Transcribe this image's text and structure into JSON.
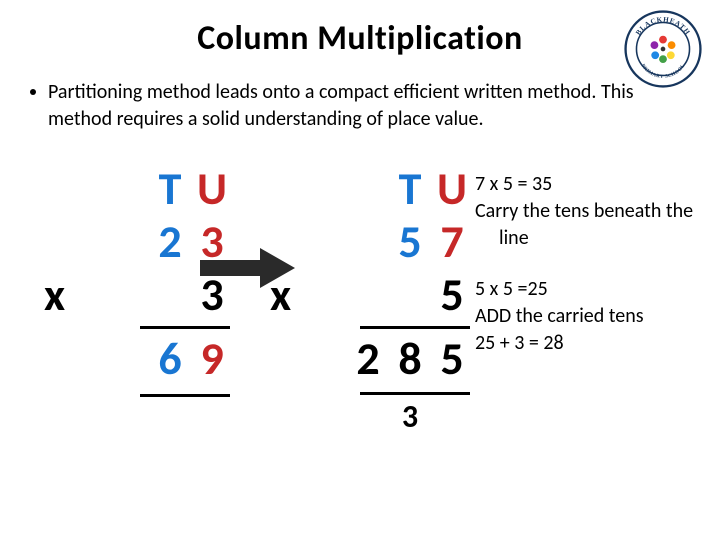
{
  "title": "Column Multiplication",
  "logo": {
    "top_text": "BLACKHEATH",
    "bottom_text": "PRIMARY SCHOOL"
  },
  "bullet": "Partitioning method leads onto a compact efficient written method. This method requires a solid understanding of place value.",
  "problem1": {
    "header_t": "T",
    "header_u": "U",
    "top_t": "2",
    "top_u": "3",
    "x": "x",
    "mult_u": "3",
    "res_t": "6",
    "res_u": "9"
  },
  "problem2": {
    "header_t": "T",
    "header_u": "U",
    "top_t": "5",
    "top_u": "7",
    "x": "x",
    "mult_u": "5",
    "res_h": "2",
    "res_t": "8",
    "res_u": "5",
    "carry": "3"
  },
  "explain": {
    "l1": "7 x 5 = 35",
    "l2a": "Carry the tens beneath the",
    "l2b": "line",
    "l3": "5 x 5 =25",
    "l4": "ADD the carried tens",
    "l5": "25 + 3 = 28"
  }
}
